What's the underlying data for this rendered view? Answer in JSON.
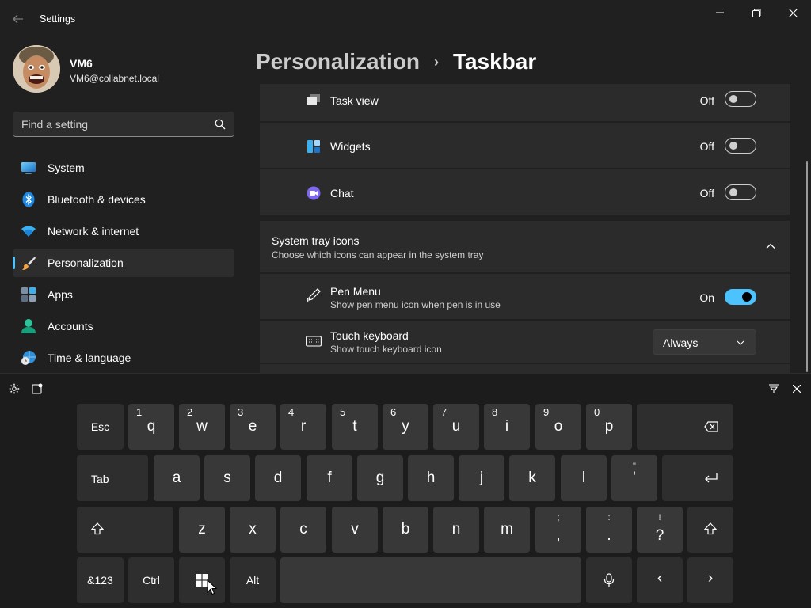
{
  "window": {
    "title": "Settings",
    "back_icon": "arrow-left-icon",
    "min_icon": "minimize-icon",
    "max_icon": "restore-icon",
    "close_icon": "close-icon"
  },
  "profile": {
    "name": "VM6",
    "email": "VM6@collabnet.local"
  },
  "search": {
    "placeholder": "Find a setting",
    "value": ""
  },
  "sidebar": {
    "items": [
      {
        "label": "System",
        "icon": "monitor-icon"
      },
      {
        "label": "Bluetooth & devices",
        "icon": "bluetooth-icon"
      },
      {
        "label": "Network & internet",
        "icon": "wifi-icon"
      },
      {
        "label": "Personalization",
        "icon": "brush-icon",
        "active": true
      },
      {
        "label": "Apps",
        "icon": "apps-icon"
      },
      {
        "label": "Accounts",
        "icon": "person-icon"
      },
      {
        "label": "Time & language",
        "icon": "globe-clock-icon"
      }
    ]
  },
  "breadcrumb": {
    "parent": "Personalization",
    "separator": "›",
    "current": "Taskbar"
  },
  "taskbar_items": [
    {
      "label": "Task view",
      "state": "Off",
      "on": false,
      "icon": "task-view-icon"
    },
    {
      "label": "Widgets",
      "state": "Off",
      "on": false,
      "icon": "widgets-icon"
    },
    {
      "label": "Chat",
      "state": "Off",
      "on": false,
      "icon": "chat-icon"
    }
  ],
  "system_tray": {
    "title": "System tray icons",
    "subtitle": "Choose which icons can appear in the system tray",
    "expanded": true,
    "pen_menu": {
      "title": "Pen Menu",
      "subtitle": "Show pen menu icon when pen is in use",
      "state": "On",
      "on": true,
      "icon": "pen-icon"
    },
    "touch_keyboard": {
      "title": "Touch keyboard",
      "subtitle": "Show touch keyboard icon",
      "value": "Always",
      "icon": "keyboard-icon"
    }
  },
  "colors": {
    "accent": "#4cc2ff",
    "background": "#202020",
    "card": "#2b2b2b",
    "key": "#383838"
  },
  "keyboard": {
    "settings_icon": "gear-icon",
    "dock_icon": "dock-icon",
    "pin_icon": "pin-icon",
    "close_icon": "close-icon",
    "row1": {
      "esc": "Esc",
      "keys": [
        {
          "ch": "q",
          "num": "1"
        },
        {
          "ch": "w",
          "num": "2"
        },
        {
          "ch": "e",
          "num": "3"
        },
        {
          "ch": "r",
          "num": "4"
        },
        {
          "ch": "t",
          "num": "5"
        },
        {
          "ch": "y",
          "num": "6"
        },
        {
          "ch": "u",
          "num": "7"
        },
        {
          "ch": "i",
          "num": "8"
        },
        {
          "ch": "o",
          "num": "9"
        },
        {
          "ch": "p",
          "num": "0"
        }
      ],
      "backspace_icon": "backspace-icon"
    },
    "row2": {
      "tab": "Tab",
      "keys": [
        "a",
        "s",
        "d",
        "f",
        "g",
        "h",
        "j",
        "k",
        "l"
      ],
      "quote": {
        "top": "\"",
        "bottom": "'"
      },
      "enter_icon": "enter-icon"
    },
    "row3": {
      "shift_icon": "shift-icon",
      "keys": [
        "z",
        "x",
        "c",
        "v",
        "b",
        "n",
        "m"
      ],
      "punct": [
        {
          "top": ";",
          "bottom": ","
        },
        {
          "top": ":",
          "bottom": "."
        },
        {
          "top": "!",
          "bottom": "?"
        }
      ]
    },
    "row4": {
      "symbols": "&123",
      "ctrl": "Ctrl",
      "win_icon": "windows-icon",
      "alt": "Alt",
      "mic_icon": "microphone-icon",
      "left": "‹",
      "right": "›"
    }
  }
}
